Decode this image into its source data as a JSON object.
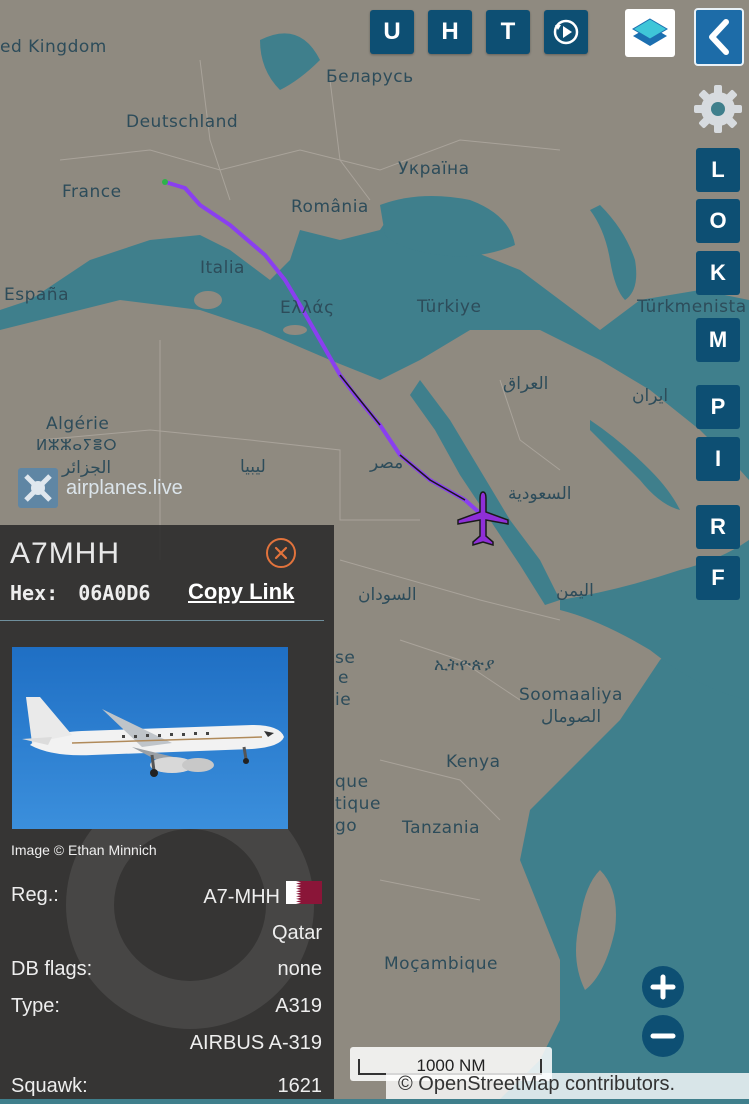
{
  "map_labels": {
    "uk": "ed Kingdom",
    "belarus": "Беларусь",
    "deutschland": "Deutschland",
    "ukraine": "Україна",
    "france": "France",
    "romania": "România",
    "italia": "Italia",
    "espana": "España",
    "greece": "Ελλάς",
    "turkiye": "Türkiye",
    "turkmenistan": "Türkmenista",
    "iraq": "العراق",
    "iran": "ایران",
    "algeria": "Algérie",
    "algeria_tif": "ⵍⵣⵣⴰⵢⴻⵔ",
    "algeria_ar": "الجزائر",
    "libya": "ليبيا",
    "egypt": "مصر",
    "saudi": "السعودية",
    "sudan": "السودان",
    "yemen": "اليمن",
    "ethiopia": "ኢትዮጵያ",
    "somalia": "Soomaaliya",
    "somalia_ar": "الصومال",
    "kenya": "Kenya",
    "tanzania": "Tanzania",
    "mozambique": "Moçambique",
    "se": "se",
    "e": "e",
    "ie": "ie",
    "que": "que",
    "tique": "tique",
    "go": "go"
  },
  "watermark": {
    "text": "airplanes.live"
  },
  "toolbar": {
    "u": "U",
    "h": "H",
    "t": "T"
  },
  "sidebar": [
    "L",
    "O",
    "K",
    "M",
    "P",
    "I",
    "R",
    "F"
  ],
  "scale": {
    "label": "1000 NM"
  },
  "attribution": "© OpenStreetMap contributors.",
  "aircraft": {
    "callsign": "A7MHH",
    "hex_label": "Hex:",
    "hex": "06A0D6",
    "copy_link": "Copy Link",
    "image_credit": "Image © Ethan Minnich",
    "reg_label": "Reg.:",
    "reg": "A7-MHH",
    "country": "Qatar",
    "dbflags_label": "DB flags:",
    "dbflags": "none",
    "type_label": "Type:",
    "type": "A319",
    "type_desc": "AIRBUS A-319",
    "squawk_label": "Squawk:",
    "squawk": "1621"
  },
  "colors": {
    "sea": "#3f7f8c",
    "land": "#8f8a80",
    "track": "#8a3ff0",
    "button": "#0d4f73",
    "plane": "#8e2fd8",
    "qatar_flag": "#8a1538"
  }
}
